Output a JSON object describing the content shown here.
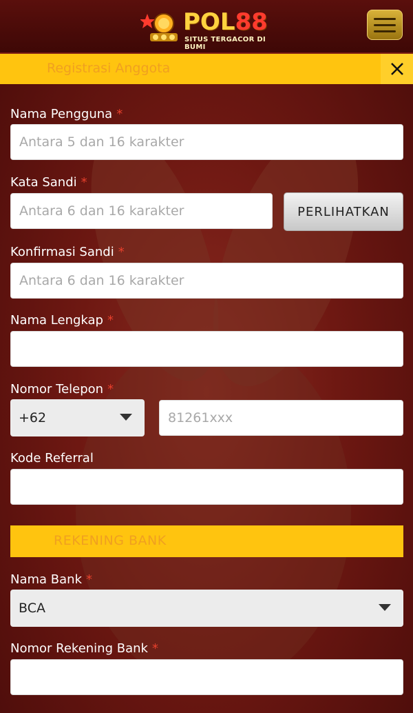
{
  "header": {
    "logo_text": "POL",
    "logo_number": "88",
    "logo_tagline": "SITUS TERGACOR DI BUMI",
    "menu_icon": "hamburger-icon"
  },
  "title_bar": {
    "title": "Registrasi Anggota",
    "close_icon": "close-icon"
  },
  "form": {
    "username": {
      "label": "Nama Pengguna",
      "required": "*",
      "placeholder": "Antara 5 dan 16 karakter",
      "value": ""
    },
    "password": {
      "label": "Kata Sandi",
      "required": "*",
      "placeholder": "Antara 6 dan 16 karakter",
      "value": "",
      "show_button": "PERLIHATKAN"
    },
    "confirm_password": {
      "label": "Konfirmasi Sandi",
      "required": "*",
      "placeholder": "Antara 6 dan 16 karakter",
      "value": ""
    },
    "full_name": {
      "label": "Nama Lengkap",
      "required": "*",
      "placeholder": "",
      "value": ""
    },
    "phone": {
      "label": "Nomor Telepon",
      "required": "*",
      "country_code": "+62",
      "placeholder": "81261xxx",
      "value": ""
    },
    "referral": {
      "label": "Kode Referral",
      "placeholder": "",
      "value": ""
    },
    "bank_section": {
      "title": "REKENING BANK"
    },
    "bank_name": {
      "label": "Nama Bank",
      "required": "*",
      "selected": "BCA"
    },
    "account_number": {
      "label": "Nomor Rekening Bank",
      "required": "*",
      "placeholder": "",
      "value": ""
    }
  },
  "colors": {
    "accent_yellow": "#ffc40f",
    "required_red": "#e8402c",
    "background_red": "#6e1812"
  }
}
